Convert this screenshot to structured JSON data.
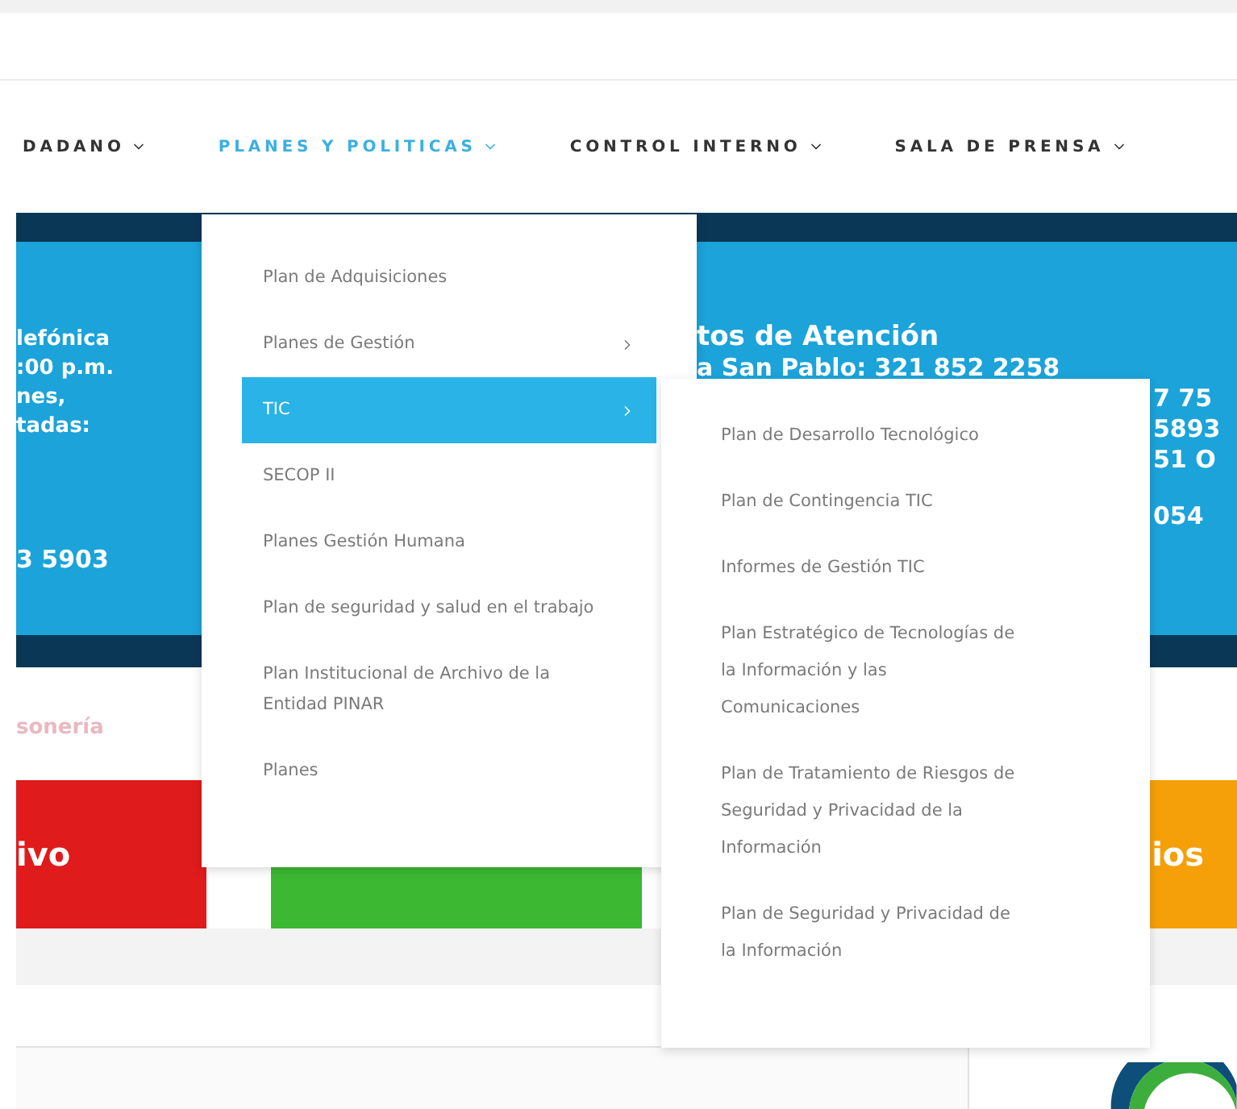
{
  "nav": [
    {
      "label": "DADANO",
      "selected": false
    },
    {
      "label": "PLANES Y POLITICAS",
      "selected": true
    },
    {
      "label": "CONTROL INTERNO",
      "selected": false
    },
    {
      "label": "SALA DE PRENSA",
      "selected": false
    }
  ],
  "banner": {
    "left_lines": [
      "lefónica",
      ":00 p.m.",
      "nes,",
      "tadas:"
    ],
    "left_phone": "3 5903",
    "right_title": "tos de Atención",
    "right_lines": [
      "a San Pablo: 321 852 2258",
      "7 75",
      "5893",
      "51 O"
    ],
    "right_phone": "054"
  },
  "tagline": "sonería",
  "tiles": [
    {
      "label": "ivo",
      "color": "#e01b1b"
    },
    {
      "color": "#3cb832"
    },
    {
      "label": "ios",
      "color": "#f5a009"
    }
  ],
  "menu": {
    "items": [
      {
        "label": "Plan de Adquisiciones",
        "selected": false,
        "has_submenu": false
      },
      {
        "label": "Planes de Gestión",
        "selected": false,
        "has_submenu": true
      },
      {
        "label": "TIC",
        "selected": true,
        "has_submenu": true
      },
      {
        "label": "SECOP II",
        "selected": false,
        "has_submenu": false
      },
      {
        "label": "Planes Gestión Humana",
        "selected": false,
        "has_submenu": false
      },
      {
        "label": "Plan de seguridad y salud en el trabajo",
        "selected": false,
        "has_submenu": false
      },
      {
        "label": "Plan Institucional de Archivo de la Entidad PINAR",
        "selected": false,
        "has_submenu": false
      },
      {
        "label": "Planes",
        "selected": false,
        "has_submenu": false
      }
    ]
  },
  "submenu": {
    "items": [
      {
        "label": "Plan de Desarrollo Tecnológico"
      },
      {
        "label": "Plan de Contingencia TIC"
      },
      {
        "label": "Informes de Gestión TIC"
      },
      {
        "label": "Plan Estratégico de Tecnologías de la Información y las Comunicaciones"
      },
      {
        "label": "Plan de Tratamiento de Riesgos de Seguridad y Privacidad de la Información"
      },
      {
        "label": "Plan de Seguridad y Privacidad de la Información"
      }
    ]
  }
}
